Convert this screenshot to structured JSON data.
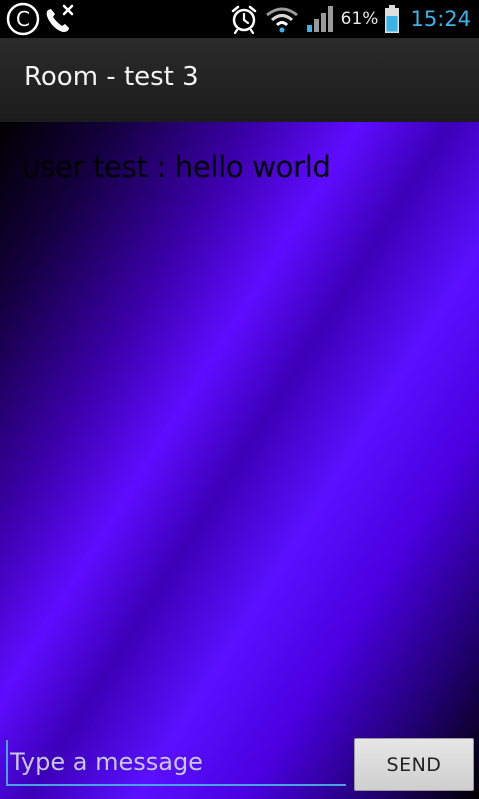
{
  "status_bar": {
    "battery_percent": "61%",
    "time": "15:24",
    "icons": [
      "c-circle-icon",
      "missed-call-icon",
      "alarm-icon",
      "wifi-icon",
      "signal-icon",
      "battery-icon"
    ],
    "time_color": "#39b4e6"
  },
  "action_bar": {
    "title": "Room - test 3"
  },
  "chat": {
    "messages": [
      {
        "text": "user test : hello world"
      }
    ]
  },
  "composer": {
    "placeholder": "Type a message",
    "value": "",
    "send_label": "SEND",
    "accent": "#4aa3df"
  },
  "colors": {
    "background_gradient": [
      "#000000",
      "#5e0cff",
      "#000000"
    ]
  }
}
